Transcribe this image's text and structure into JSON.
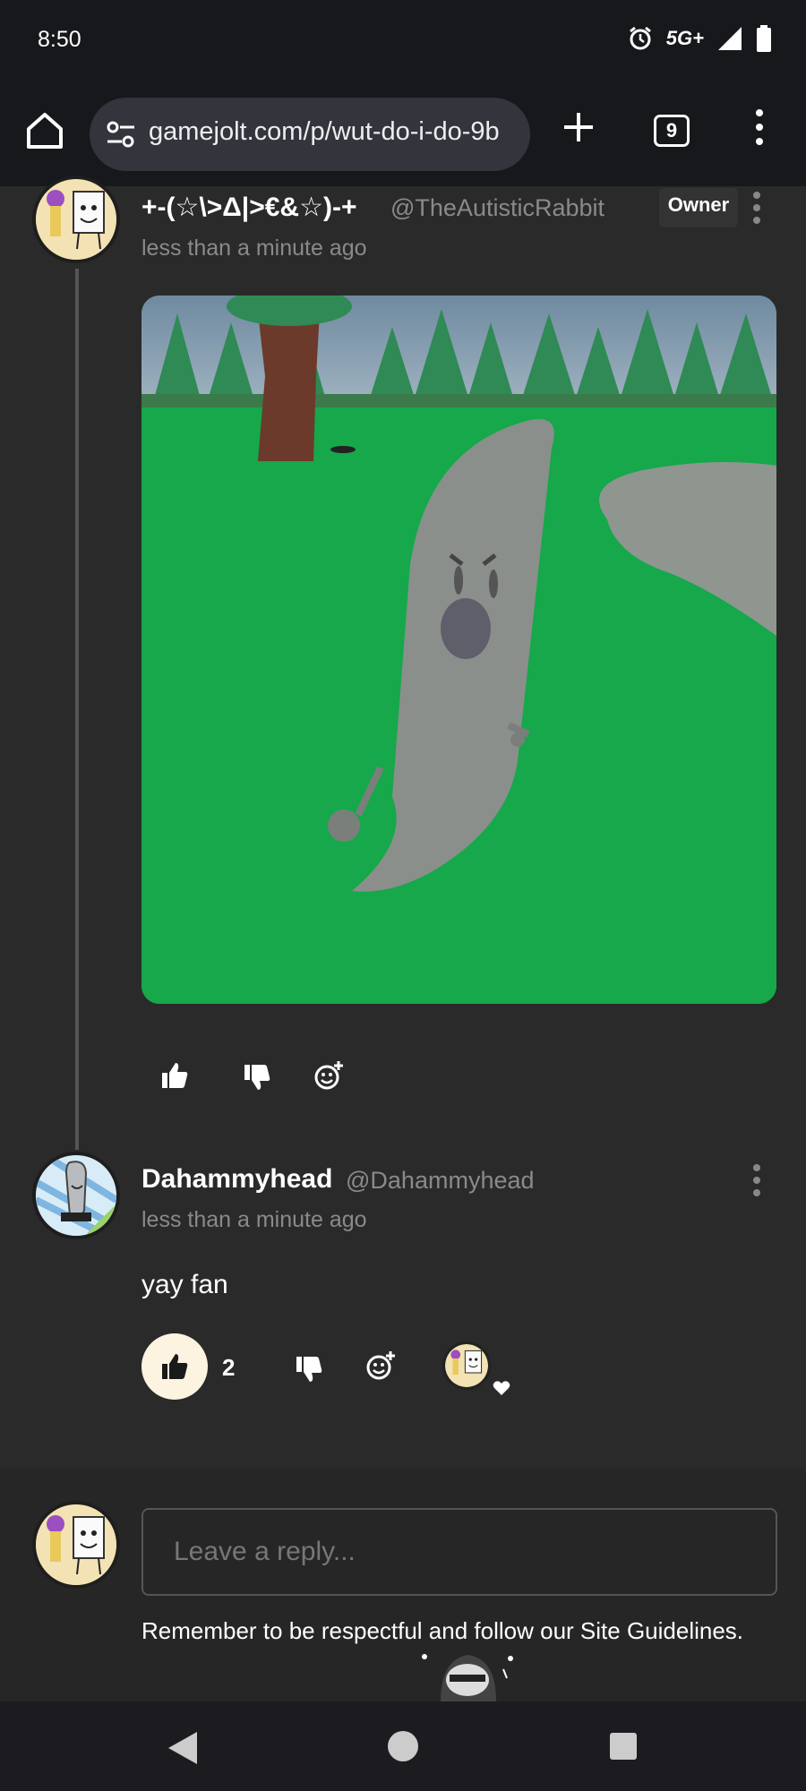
{
  "status_bar": {
    "time": "8:50",
    "network": "5G+"
  },
  "browser": {
    "url": "gamejolt.com/p/wut-do-i-do-9b",
    "tab_count": "9"
  },
  "post": {
    "author_name": "+-(☆\\>Δ|>€&☆)-+",
    "author_handle": "@TheAutisticRabbit",
    "badge": "Owner",
    "timestamp": "less than a minute ago"
  },
  "comment": {
    "author_name": "Dahammyhead",
    "author_handle": "@Dahammyhead",
    "timestamp": "less than a minute ago",
    "text": "yay fan",
    "like_count": "2"
  },
  "reply": {
    "placeholder": "Leave a reply...",
    "guidelines": "Remember to be respectful and follow our Site Guidelines."
  },
  "colors": {
    "accent_green": "#13a84a",
    "like_bg": "#fdf3e1"
  }
}
